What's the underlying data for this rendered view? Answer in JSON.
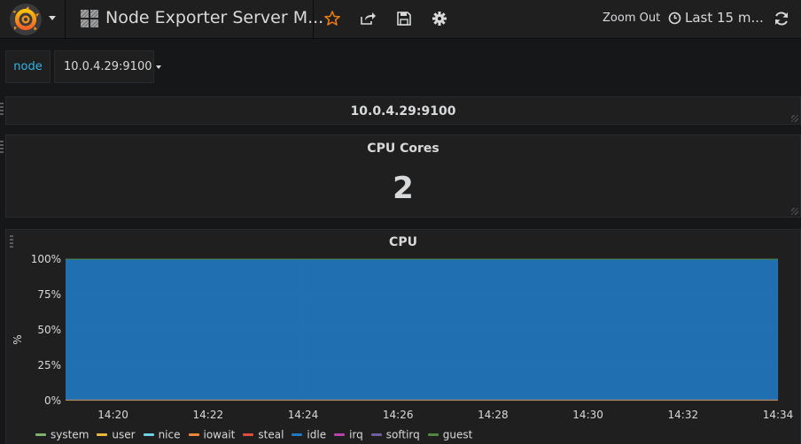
{
  "navbar": {
    "title": "Node Exporter Server M...",
    "zoom_out_label": "Zoom Out",
    "time_range_label": "Last 15 m...",
    "icons": [
      "grafana-logo-icon",
      "dashboard-grid-icon",
      "star-icon",
      "share-icon",
      "save-icon",
      "gear-icon",
      "clock-icon",
      "refresh-icon"
    ]
  },
  "variables": {
    "label": "node",
    "value": "10.0.4.29:9100"
  },
  "panels": {
    "row_title": "10.0.4.29:9100",
    "cpu_cores": {
      "title": "CPU Cores",
      "value": "2"
    },
    "cpu_graph": {
      "title": "CPU"
    }
  },
  "colors": {
    "accent_link": "#33b5e5",
    "star": "#eb7b18",
    "idle_fill": "#1f78c1"
  },
  "chart_data": {
    "type": "area",
    "title": "CPU",
    "ylabel": "%",
    "xlabel": "",
    "y_ticks": [
      "100%",
      "75%",
      "50%",
      "25%",
      "0%"
    ],
    "ylim": [
      0,
      100
    ],
    "x_ticks": [
      "14:20",
      "14:22",
      "14:24",
      "14:26",
      "14:28",
      "14:30",
      "14:32",
      "14:34"
    ],
    "x": [
      "14:19",
      "14:20",
      "14:21",
      "14:22",
      "14:23",
      "14:24",
      "14:25",
      "14:26",
      "14:27",
      "14:28",
      "14:29",
      "14:30",
      "14:31",
      "14:32",
      "14:33",
      "14:34"
    ],
    "xlim": [
      "14:19",
      "14:34"
    ],
    "stacked": true,
    "grid": true,
    "legend_position": "bottom",
    "series": [
      {
        "name": "system",
        "color": "#7eb26d",
        "values": [
          0.3,
          0.3,
          0.3,
          0.3,
          0.3,
          0.3,
          0.3,
          0.3,
          0.3,
          0.3,
          0.3,
          0.3,
          0.3,
          0.3,
          0.3,
          0.3
        ]
      },
      {
        "name": "user",
        "color": "#eab839",
        "values": [
          0.4,
          0.4,
          0.4,
          0.4,
          0.4,
          0.4,
          0.4,
          0.4,
          0.4,
          0.4,
          0.4,
          0.4,
          0.4,
          0.4,
          0.4,
          0.4
        ]
      },
      {
        "name": "nice",
        "color": "#6ed0e0",
        "values": [
          0,
          0,
          0,
          0,
          0,
          0,
          0,
          0,
          0,
          0,
          0,
          0,
          0,
          0,
          0,
          0
        ]
      },
      {
        "name": "iowait",
        "color": "#ef843c",
        "values": [
          0,
          0,
          0,
          0,
          0,
          0,
          0,
          0,
          0,
          0,
          0,
          0,
          0,
          0,
          0,
          0
        ]
      },
      {
        "name": "steal",
        "color": "#e24d42",
        "values": [
          0,
          0,
          0,
          0,
          0,
          0,
          0,
          0,
          0,
          0,
          0,
          0,
          0,
          0,
          0,
          0
        ]
      },
      {
        "name": "idle",
        "color": "#1f78c1",
        "values": [
          99.3,
          99.3,
          99.3,
          99.3,
          99.3,
          99.3,
          99.3,
          99.3,
          99.3,
          99.3,
          99.3,
          99.3,
          99.3,
          99.3,
          99.3,
          99.3
        ]
      },
      {
        "name": "irq",
        "color": "#ba43a9",
        "values": [
          0,
          0,
          0,
          0,
          0,
          0,
          0,
          0,
          0,
          0,
          0,
          0,
          0,
          0,
          0,
          0
        ]
      },
      {
        "name": "softirq",
        "color": "#705da0",
        "values": [
          0,
          0,
          0,
          0,
          0,
          0,
          0,
          0,
          0,
          0,
          0,
          0,
          0,
          0,
          0,
          0
        ]
      },
      {
        "name": "guest",
        "color": "#508642",
        "values": [
          0,
          0,
          0,
          0,
          0,
          0,
          0,
          0,
          0,
          0,
          0,
          0,
          0,
          0,
          0,
          0
        ]
      }
    ]
  }
}
